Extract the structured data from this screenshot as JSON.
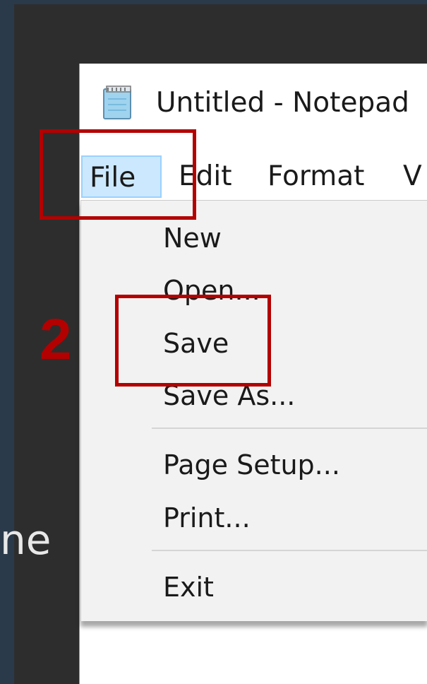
{
  "background_side_text": "ne",
  "window": {
    "title": "Untitled - Notepad",
    "icon": "notepad-icon"
  },
  "menubar": {
    "items": [
      "File",
      "Edit",
      "Format",
      "V"
    ]
  },
  "file_menu": {
    "items": [
      "New",
      "Open...",
      "Save",
      "Save As...",
      "Page Setup...",
      "Print...",
      "Exit"
    ]
  },
  "annotations": {
    "step_number": "2",
    "color": "#b30000"
  },
  "colors": {
    "menu_highlight": "#cce8ff",
    "menu_bg": "#f2f2f2"
  }
}
